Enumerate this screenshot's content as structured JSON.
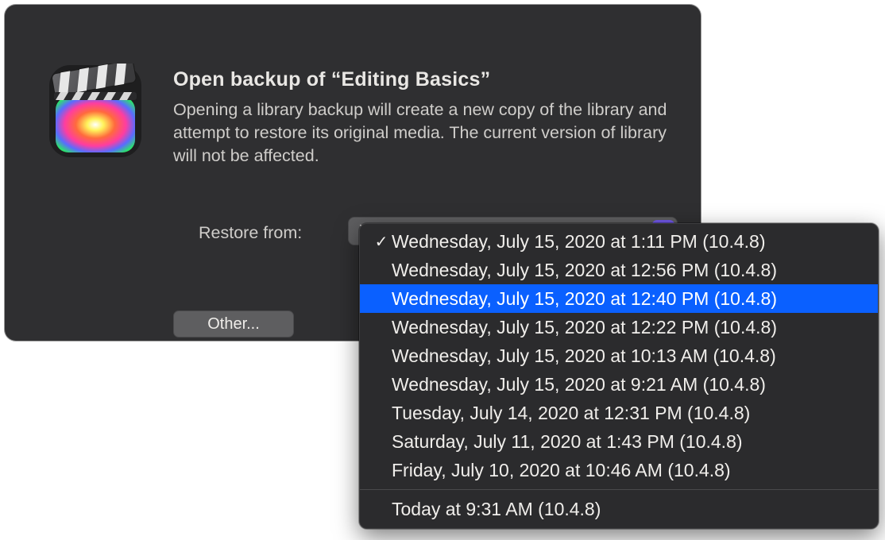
{
  "dialog": {
    "title": "Open backup of “Editing Basics”",
    "description": "Opening a library backup will create a new copy of the library and attempt to restore its original media. The current version of library will not be affected.",
    "restore_label": "Restore from:",
    "popup_selected_text": "W",
    "other_button": "Other..."
  },
  "menu": {
    "items": [
      "Wednesday, July 15, 2020 at 1:11 PM (10.4.8)",
      "Wednesday, July 15, 2020 at 12:56 PM (10.4.8)",
      "Wednesday, July 15, 2020 at 12:40 PM (10.4.8)",
      "Wednesday, July 15, 2020 at 12:22 PM (10.4.8)",
      "Wednesday, July 15, 2020 at 10:13 AM (10.4.8)",
      "Wednesday, July 15, 2020 at 9:21 AM (10.4.8)",
      "Tuesday, July 14, 2020 at 12:31 PM (10.4.8)",
      "Saturday, July 11, 2020 at 1:43 PM (10.4.8)",
      "Friday, July 10, 2020 at 10:46 AM (10.4.8)"
    ],
    "footer_item": "Today at 9:31 AM (10.4.8)",
    "selected_index": 0,
    "highlighted_index": 2
  }
}
